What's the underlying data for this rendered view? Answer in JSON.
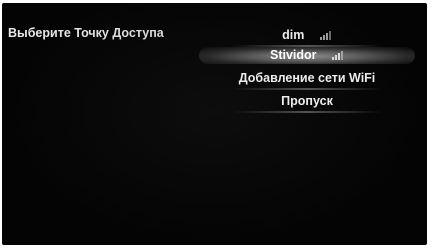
{
  "header": {
    "title": "Выберите Точку Доступа"
  },
  "access_points": {
    "items": [
      {
        "label": "dim",
        "signal_icon": "wifi-signal-icon",
        "selected": false
      },
      {
        "label": "Stividor",
        "signal_icon": "wifi-signal-icon",
        "selected": true
      },
      {
        "label": "Добавление сети WiFi",
        "selected": false
      },
      {
        "label": "Пропуск",
        "selected": false
      }
    ]
  },
  "colors": {
    "background": "#040404",
    "text": "#ececec",
    "highlight": "#7a7a7a"
  }
}
